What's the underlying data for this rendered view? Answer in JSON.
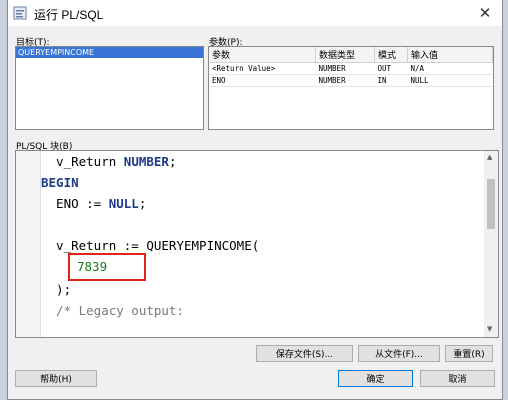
{
  "window": {
    "title": "运行 PL/SQL",
    "close_glyph": "✕"
  },
  "target": {
    "label": "目标(T):",
    "items": [
      "QUERYEMPINCOME"
    ]
  },
  "params": {
    "label": "参数(P):",
    "columns": [
      "参数",
      "数据类型",
      "模式",
      "输入值"
    ],
    "rows": [
      [
        "<Return Value>",
        "NUMBER",
        "OUT",
        "N/A"
      ],
      [
        "ENO",
        "NUMBER",
        "IN",
        "NULL"
      ]
    ]
  },
  "block": {
    "label": "PL/SQL 块(B)",
    "lines": {
      "l1a": "  v_Return ",
      "l1b": "NUMBER",
      "l1c": ";",
      "l2": "BEGIN",
      "l3a": "  ENO := ",
      "l3b": "NULL",
      "l3c": ";",
      "l5": "  v_Return := QUERYEMPINCOME(",
      "l6": "7839",
      "l7": "  );",
      "l8": "  /* Legacy output:"
    }
  },
  "buttons": {
    "save_file": "保存文件(S)...",
    "from_file": "从文件(F)...",
    "reset": "重置(R)",
    "help": "帮助(H)",
    "ok": "确定",
    "cancel": "取消"
  },
  "colors": {
    "selection": "#3875d7",
    "highlight_box": "#e0261b",
    "keyword": "#1f3a8a",
    "number": "#1a7a1a"
  }
}
